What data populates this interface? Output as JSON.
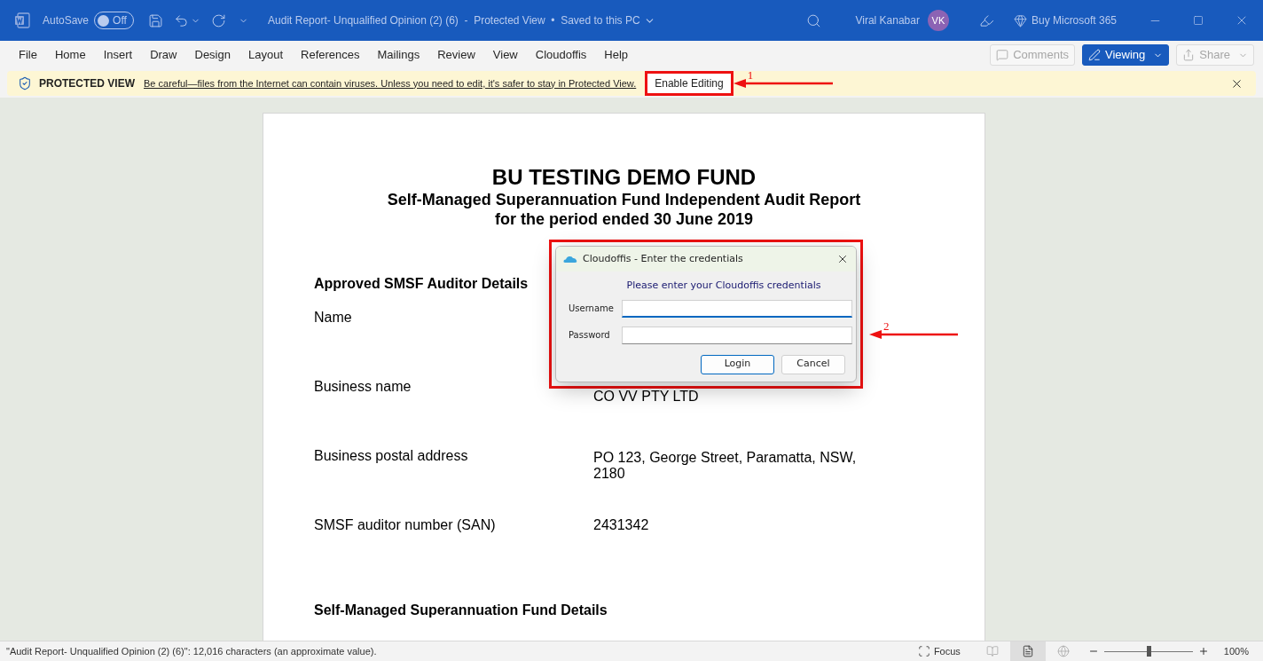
{
  "title_bar": {
    "autosave_label": "AutoSave",
    "autosave": {
      "on": false,
      "label": "Off"
    },
    "document_title": "Audit Report- Unqualified Opinion (2) (6)  -  Protected View  •  Saved to this PC",
    "user_name": "Viral Kanabar",
    "avatar_initials": "VK",
    "buy_label": "Buy Microsoft 365"
  },
  "ribbon": {
    "tabs": [
      {
        "label": "File"
      },
      {
        "label": "Home"
      },
      {
        "label": "Insert"
      },
      {
        "label": "Draw"
      },
      {
        "label": "Design"
      },
      {
        "label": "Layout"
      },
      {
        "label": "References"
      },
      {
        "label": "Mailings"
      },
      {
        "label": "Review"
      },
      {
        "label": "View"
      },
      {
        "label": "Cloudoffis"
      },
      {
        "label": "Help"
      }
    ],
    "buttons": [
      {
        "kind": "comments",
        "label": "Comments",
        "disabled": true
      },
      {
        "kind": "viewing",
        "label": "Viewing"
      },
      {
        "kind": "share",
        "label": "Share",
        "disabled": true
      }
    ]
  },
  "protected_view": {
    "label": "PROTECTED VIEW",
    "message": "Be careful—files from the Internet can contain viruses. Unless you need to edit, it's safer to stay in Protected View.",
    "button": "Enable Editing"
  },
  "annotations": [
    {
      "number": "1"
    },
    {
      "number": "2"
    }
  ],
  "document": {
    "title": "BU TESTING DEMO FUND",
    "subtitle_lines": [
      "Self-Managed Superannuation Fund Independent Audit Report",
      "for the period ended 30 June 2019"
    ],
    "sections": [
      {
        "heading": "Approved SMSF Auditor Details",
        "rows": [
          {
            "label": "Name"
          },
          {
            "label": "Business name",
            "value_lines": [
              "CO VV PTY LTD"
            ]
          },
          {
            "label": "Business postal address",
            "value_lines": [
              "PO 123, George Street, Paramatta, NSW,",
              "2180"
            ]
          },
          {
            "label": "SMSF auditor number (SAN)",
            "value_lines": [
              "2431342"
            ]
          }
        ]
      },
      {
        "heading": "Self-Managed Superannuation Fund Details"
      }
    ]
  },
  "dialog": {
    "title": "Cloudoffis - Enter the credentials",
    "prompt": "Please enter your Cloudoffis credentials",
    "fields": [
      {
        "label": "Username",
        "focused": true
      },
      {
        "label": "Password",
        "focused": false
      }
    ],
    "buttons": [
      {
        "label": "Login",
        "default": true
      },
      {
        "label": "Cancel",
        "default": false
      }
    ]
  },
  "status_bar": {
    "text": "\"Audit Report- Unqualified Opinion (2) (6)\": 12,016 characters (an approximate value).",
    "focus_label": "Focus",
    "views": [
      {
        "kind": "read",
        "selected": false
      },
      {
        "kind": "print",
        "selected": true
      },
      {
        "kind": "web",
        "selected": false
      }
    ],
    "zoom": {
      "level": 0.5,
      "label": "100%"
    }
  }
}
